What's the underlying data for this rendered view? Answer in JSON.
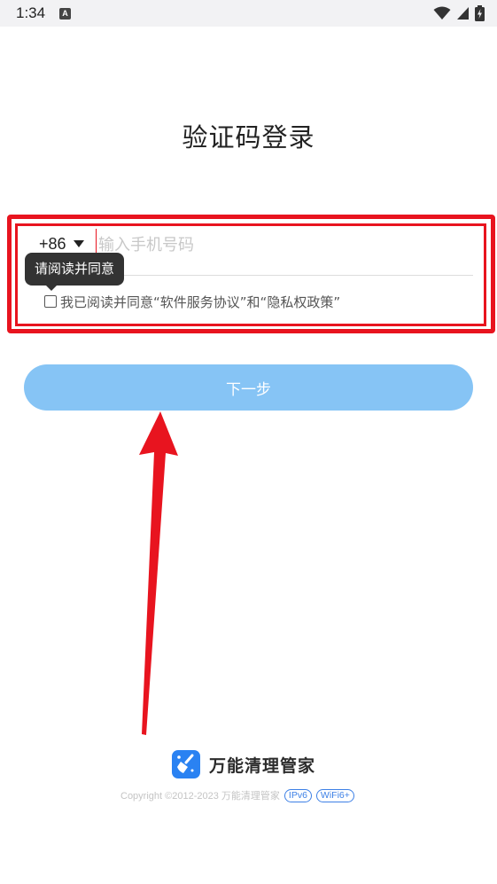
{
  "status_bar": {
    "time": "1:34",
    "notif_icon": "A"
  },
  "title": "验证码登录",
  "login": {
    "country_code": "+86",
    "phone_placeholder": "输入手机号码",
    "tooltip": "请阅读并同意",
    "agreement_text": "我已阅读并同意“软件服务协议”和“隐私权政策”",
    "next_label": "下一步"
  },
  "brand": {
    "name": "万能清理管家",
    "copyright": "Copyright ©2012-2023 万能清理管家",
    "badges": [
      "IPv6",
      "WiFi6+"
    ]
  },
  "colors": {
    "accent": "#86c4f5",
    "highlight": "#e8141f",
    "brand": "#2a82f2"
  }
}
